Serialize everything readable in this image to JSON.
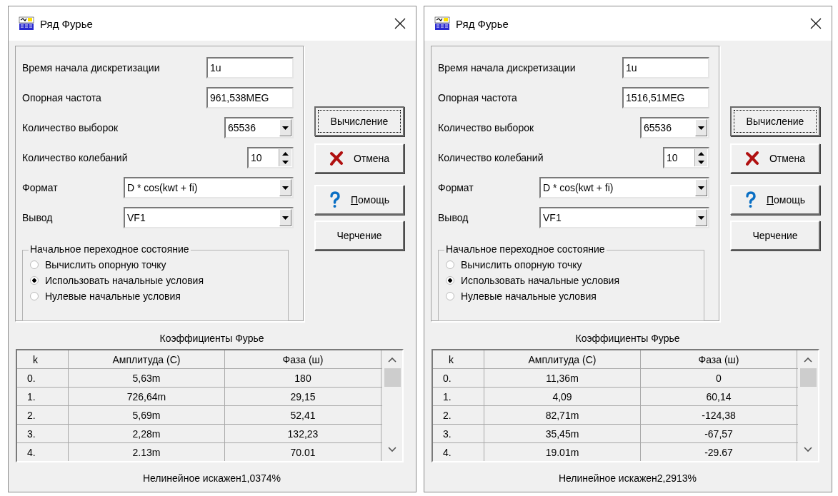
{
  "dialogs": [
    {
      "title": "Ряд Фурье",
      "fields": [
        {
          "kind": "text",
          "label": "Время начала дискретизации",
          "value": "1u"
        },
        {
          "kind": "text",
          "label": "Опорная частота",
          "value": "961,538MEG"
        },
        {
          "kind": "short-combo",
          "label": "Количество выборок",
          "value": "65536"
        },
        {
          "kind": "spin",
          "label": "Количество колебаний",
          "value": "10"
        },
        {
          "kind": "combo",
          "label": "Формат",
          "value": "D * cos(kwt + fi)"
        },
        {
          "kind": "combo",
          "label": "Вывод",
          "value": "VF1"
        }
      ],
      "group": {
        "title": "Начальное переходное состояние",
        "options": [
          {
            "label": "Вычислить опорную точку",
            "selected": false
          },
          {
            "label": "Использовать начальные условия",
            "selected": true
          },
          {
            "label": "Нулевые начальные условия",
            "selected": false
          }
        ]
      },
      "buttons": [
        {
          "kind": "default",
          "label": "Вычисление"
        },
        {
          "kind": "cancel",
          "label": "Отмена"
        },
        {
          "kind": "help",
          "label": "Помощь"
        },
        {
          "kind": "plain",
          "label": "Черчение"
        }
      ],
      "table": {
        "title": "Коэффициенты Фурье",
        "columns": [
          "k",
          "Амплитуда (С)",
          "Фаза (ш)"
        ],
        "rows": [
          [
            "0.",
            "5,63m",
            "180"
          ],
          [
            "1.",
            "726,64m",
            "29,15"
          ],
          [
            "2.",
            "5,69m",
            "52,41"
          ],
          [
            "3.",
            "2,28m",
            "132,23"
          ],
          [
            "4.",
            "2.13m",
            "70.01"
          ]
        ]
      },
      "footer": "Нелинейное искажен1,0374%"
    },
    {
      "title": "Ряд Фурье",
      "fields": [
        {
          "kind": "text",
          "label": "Время начала дискретизации",
          "value": "1u"
        },
        {
          "kind": "text",
          "label": "Опорная частота",
          "value": "1516,51MEG"
        },
        {
          "kind": "short-combo",
          "label": "Количество выборок",
          "value": "65536"
        },
        {
          "kind": "spin",
          "label": "Количество колебаний",
          "value": "10"
        },
        {
          "kind": "combo",
          "label": "Формат",
          "value": "D * cos(kwt + fi)"
        },
        {
          "kind": "combo",
          "label": "Вывод",
          "value": "VF1"
        }
      ],
      "group": {
        "title": "Начальное переходное состояние",
        "options": [
          {
            "label": "Вычислить опорную точку",
            "selected": false
          },
          {
            "label": "Использовать начальные условия",
            "selected": true
          },
          {
            "label": "Нулевые начальные условия",
            "selected": false
          }
        ]
      },
      "buttons": [
        {
          "kind": "default",
          "label": "Вычисление"
        },
        {
          "kind": "cancel",
          "label": "Отмена"
        },
        {
          "kind": "help",
          "label": "Помощь"
        },
        {
          "kind": "plain",
          "label": "Черчение"
        }
      ],
      "table": {
        "title": "Коэффициенты Фурье",
        "columns": [
          "k",
          "Амплитуда (С)",
          "Фаза (ш)"
        ],
        "rows": [
          [
            "0.",
            "11,36m",
            "0"
          ],
          [
            "1.",
            "4,09",
            "60,14"
          ],
          [
            "2.",
            "82,71m",
            "-124,38"
          ],
          [
            "3.",
            "35,45m",
            "-67,57"
          ],
          [
            "4.",
            "19.01m",
            "-29.67"
          ]
        ]
      },
      "footer": "Нелинейное искажен2,2913%"
    }
  ]
}
